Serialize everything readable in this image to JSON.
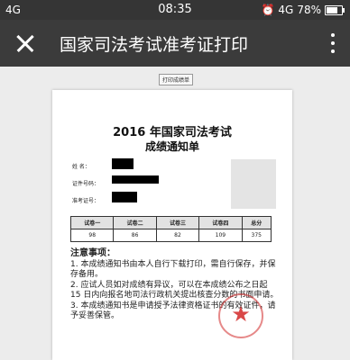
{
  "status_bar": {
    "left_network": "4G",
    "time": "08:35",
    "right_network": "4G",
    "battery_level": "78%",
    "battery_fraction": 0.78
  },
  "app_bar": {
    "title": "国家司法考试准考证打印",
    "close_icon": "close-icon",
    "menu_icon": "more-vertical-icon"
  },
  "print_button_label": "打印成绩单",
  "document": {
    "title": "2016 年国家司法考试",
    "subtitle": "成绩通知单",
    "fields": {
      "name_label": "姓    名：",
      "id_label": "证件号码：",
      "ticket_label": "准考证号："
    },
    "table": {
      "headers": [
        "试卷一",
        "试卷二",
        "试卷三",
        "试卷四",
        "总分"
      ],
      "values": [
        "98",
        "86",
        "82",
        "109",
        "375"
      ]
    },
    "notes": {
      "heading": "注意事项：",
      "items": [
        "1. 本成绩通知书由本人自行下载打印，需自行保存，并保存备用。",
        "2. 应试人员如对成绩有异议，可以在本成绩公布之日起 15 日内向报名地司法行政机关提出核查分数的书面申请。",
        "3. 本成绩通知书是申请授予法律资格证书的有效证件，请予妥善保管。"
      ]
    }
  }
}
